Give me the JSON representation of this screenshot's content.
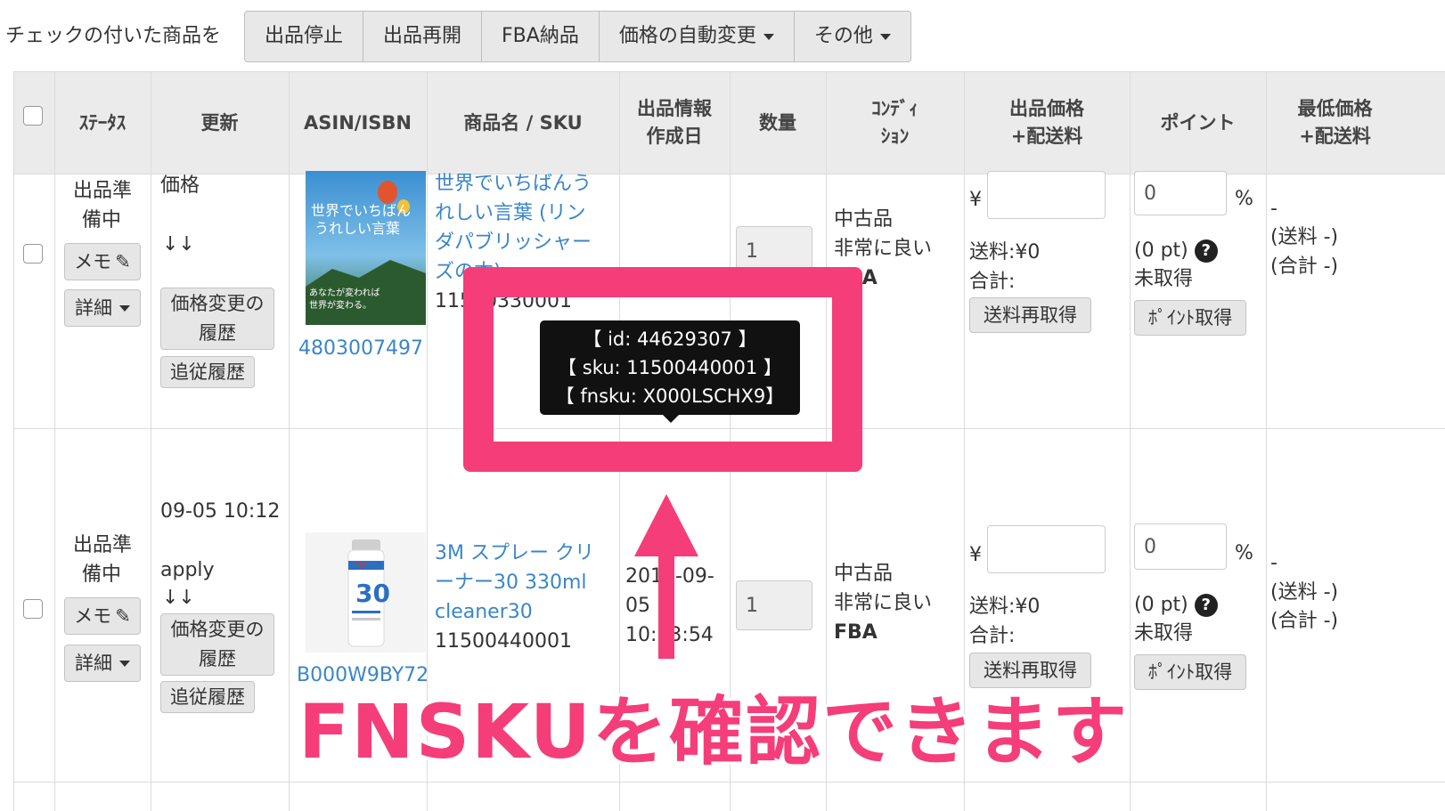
{
  "toolbar": {
    "label": "チェックの付いた商品を",
    "buttons": [
      "出品停止",
      "出品再開",
      "FBA納品",
      "価格の自動変更",
      "その他"
    ]
  },
  "table": {
    "headers": {
      "status": "ｽﾃｰﾀｽ",
      "update": "更新",
      "asin": "ASIN/ISBN",
      "name": "商品名 / SKU",
      "created_1": "出品情報",
      "created_2": "作成日",
      "qty": "数量",
      "cond_1": "ｺﾝﾃﾞｨ",
      "cond_2": "ｼｮﾝ",
      "price_1": "出品価格",
      "price_2": "+配送料",
      "points": "ポイント",
      "min_1": "最低価格",
      "min_2": "+配送料"
    },
    "rows": [
      {
        "status_1": "出品準",
        "status_2": "備中",
        "memo": "メモ",
        "detail": "詳細",
        "update_label": "価格",
        "update_arrows": "↓↓",
        "price_history_1": "価格変更の",
        "price_history_2": "履歴",
        "follow_history": "追従履歴",
        "asin": "4803007497",
        "thumb_line1": "世界でいちばん",
        "thumb_line2": "うれしい言葉",
        "thumb_line3": "あなたが変われば",
        "thumb_line4": "世界が変わる。",
        "name_1": "世界でいちばんう",
        "name_2": "れしい言葉 (リン",
        "name_3": "ダパブリッシャー",
        "name_4": "ズの本)",
        "sku": "11500330001",
        "created_1": "",
        "qty": "1",
        "cond_1": "中古品",
        "cond_2": "非常に良い",
        "cond_3": "FBA",
        "yen": "¥",
        "price_value": "",
        "shipping": "送料:¥0",
        "total": "合計:",
        "reship": "送料再取得",
        "points_value": "0",
        "percent": "%",
        "pt": "(0 pt)",
        "unacquired": "未取得",
        "point_btn": "ﾎﾟｲﾝﾄ取得",
        "min_dash": "-",
        "min_ship": "(送料 -)",
        "min_total": "(合計 -)"
      },
      {
        "status_1": "出品準",
        "status_2": "備中",
        "memo": "メモ",
        "detail": "詳細",
        "update_time": "09-05 10:12",
        "update_label": "apply",
        "update_arrows": "↓↓",
        "price_history_1": "価格変更の",
        "price_history_2": "履歴",
        "follow_history": "追従履歴",
        "asin": "B000W9BY72",
        "thumb_line1": "3M",
        "thumb_line2": "30",
        "name_1": "3M スプレー クリ",
        "name_2": "ーナー30 330ml",
        "name_3": "cleaner30",
        "sku": "11500440001",
        "created_1": "2017-09-",
        "created_2": "05",
        "created_3": "10:13:54",
        "qty": "1",
        "cond_1": "中古品",
        "cond_2": "非常に良い",
        "cond_3": "FBA",
        "yen": "¥",
        "price_value": "",
        "shipping": "送料:¥0",
        "total": "合計:",
        "reship": "送料再取得",
        "points_value": "0",
        "percent": "%",
        "pt": "(0 pt)",
        "unacquired": "未取得",
        "point_btn": "ﾎﾟｲﾝﾄ取得",
        "min_dash": "-",
        "min_ship": "(送料 -)",
        "min_total": "(合計 -)"
      }
    ]
  },
  "tooltip": {
    "line1": "【 id: 44629307 】",
    "line2": "【 sku: 11500440001 】",
    "line3": "【 fnsku: X000LSCHX9】"
  },
  "annotation": {
    "caption": "FNSKUを確認できます",
    "accent_color": "#f53d79"
  },
  "icons": {
    "pencil": "pencil-icon",
    "caret": "caret-down-icon",
    "help": "question-circle-icon"
  }
}
